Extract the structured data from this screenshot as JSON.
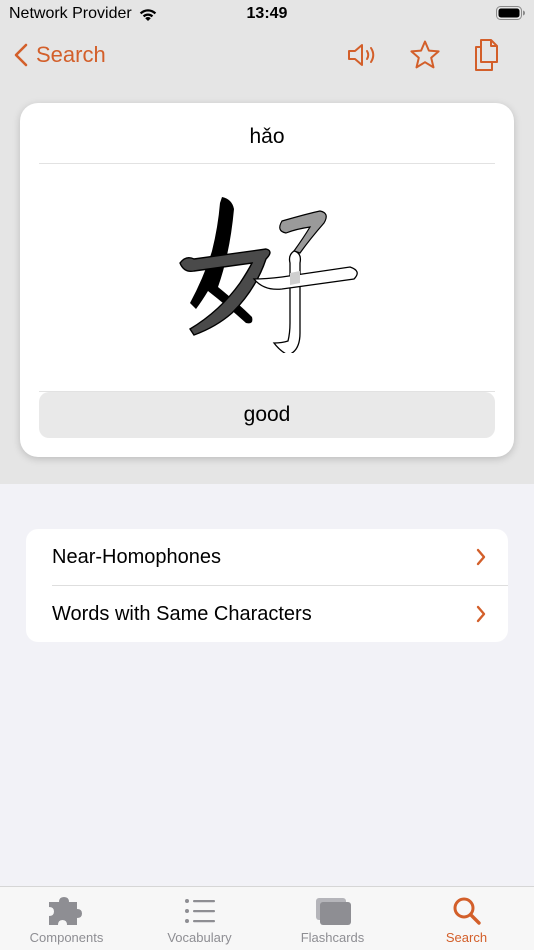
{
  "status_bar": {
    "carrier": "Network Provider",
    "time": "13:49"
  },
  "nav": {
    "back_label": "Search",
    "icons": [
      "speaker-icon",
      "star-icon",
      "copy-icon"
    ]
  },
  "card": {
    "pinyin": "hǎo",
    "character": "好",
    "meaning": "good"
  },
  "list": {
    "items": [
      {
        "label": "Near-Homophones"
      },
      {
        "label": "Words with Same Characters"
      }
    ]
  },
  "tabs": [
    {
      "label": "Components",
      "icon": "puzzle-icon",
      "active": false
    },
    {
      "label": "Vocabulary",
      "icon": "list-icon",
      "active": false
    },
    {
      "label": "Flashcards",
      "icon": "cards-icon",
      "active": false
    },
    {
      "label": "Search",
      "icon": "search-icon",
      "active": true
    }
  ],
  "colors": {
    "accent": "#d35f2a",
    "inactive": "#8e8e93",
    "background": "#f2f2f7",
    "header_background": "#e5e5e5"
  }
}
